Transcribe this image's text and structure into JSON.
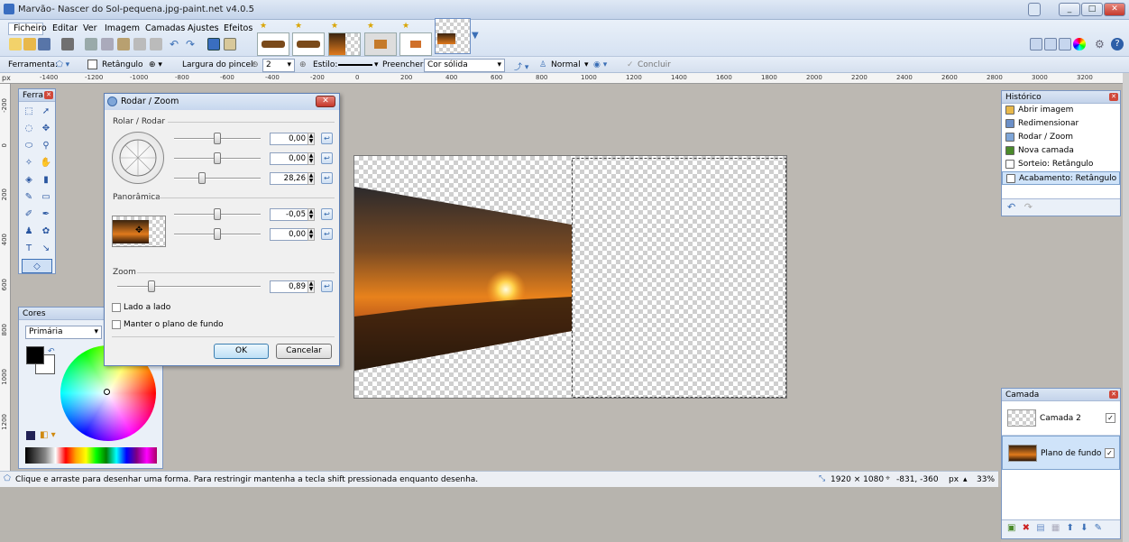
{
  "window": {
    "title": "Marvão- Nascer do Sol-pequena.jpg-paint.net v4.0.5",
    "buttons": [
      "_",
      "□",
      "✕"
    ]
  },
  "menu": [
    "Ficheiro",
    "Editar",
    "Ver",
    "Imagem",
    "Camadas",
    "Ajustes",
    "Efeitos"
  ],
  "options_bar": {
    "tool_label": "Ferramenta:",
    "shape": "Retângulo",
    "brush_width_label": "Largura do pincel:",
    "brush_width": "2",
    "style_label": "Estilo:",
    "fill_label": "Preencher:",
    "fill_value": "Cor sólida",
    "blend_mode": "Normal",
    "finish": "Concluir"
  },
  "rulers": {
    "unit": "px",
    "h_ticks": [
      "-1400",
      "-1200",
      "-1000",
      "-800",
      "-600",
      "-400",
      "-200",
      "0",
      "200",
      "400",
      "600",
      "800",
      "1000",
      "1200",
      "1400",
      "1600",
      "1800",
      "2000",
      "2200",
      "2400",
      "2600",
      "2800",
      "3000",
      "3200"
    ],
    "v_ticks": [
      "-200",
      "0",
      "200",
      "400",
      "600",
      "800",
      "1000",
      "1200"
    ]
  },
  "tools_panel": {
    "title": "Ferra..."
  },
  "colors_panel": {
    "title": "Cores",
    "mode": "Primária"
  },
  "dialog": {
    "title": "Rodar / Zoom",
    "section_rotate": "Rolar / Rodar",
    "rotate_values": [
      "0,00",
      "0,00",
      "28,26"
    ],
    "section_pan": "Panorâmica",
    "pan_values": [
      "-0,05",
      "0,00"
    ],
    "section_zoom": "Zoom",
    "zoom_value": "0,89",
    "tile_label": "Lado a lado",
    "keep_bg_label": "Manter o plano de fundo",
    "ok": "OK",
    "cancel": "Cancelar"
  },
  "history": {
    "title": "Histórico",
    "items": [
      "Abrir imagem",
      "Redimensionar",
      "Rodar / Zoom",
      "Nova camada",
      "Sorteio: Retângulo",
      "Acabamento: Retângulo"
    ],
    "selected_index": 5
  },
  "layers": {
    "title": "Camada",
    "items": [
      {
        "name": "Camada 2",
        "visible": true
      },
      {
        "name": "Plano de fundo",
        "visible": true
      }
    ]
  },
  "status": {
    "hint": "Clique e arraste para desenhar uma forma. Para restringir mantenha a tecla shift pressionada enquanto desenha.",
    "image_size": "1920 × 1080",
    "cursor": "-831, -360",
    "unit": "px",
    "zoom": "33%"
  },
  "colors": {
    "accent": "#3b6fb6",
    "panel_bg": "#eaf0f8",
    "workspace": "#bcb8b2"
  }
}
